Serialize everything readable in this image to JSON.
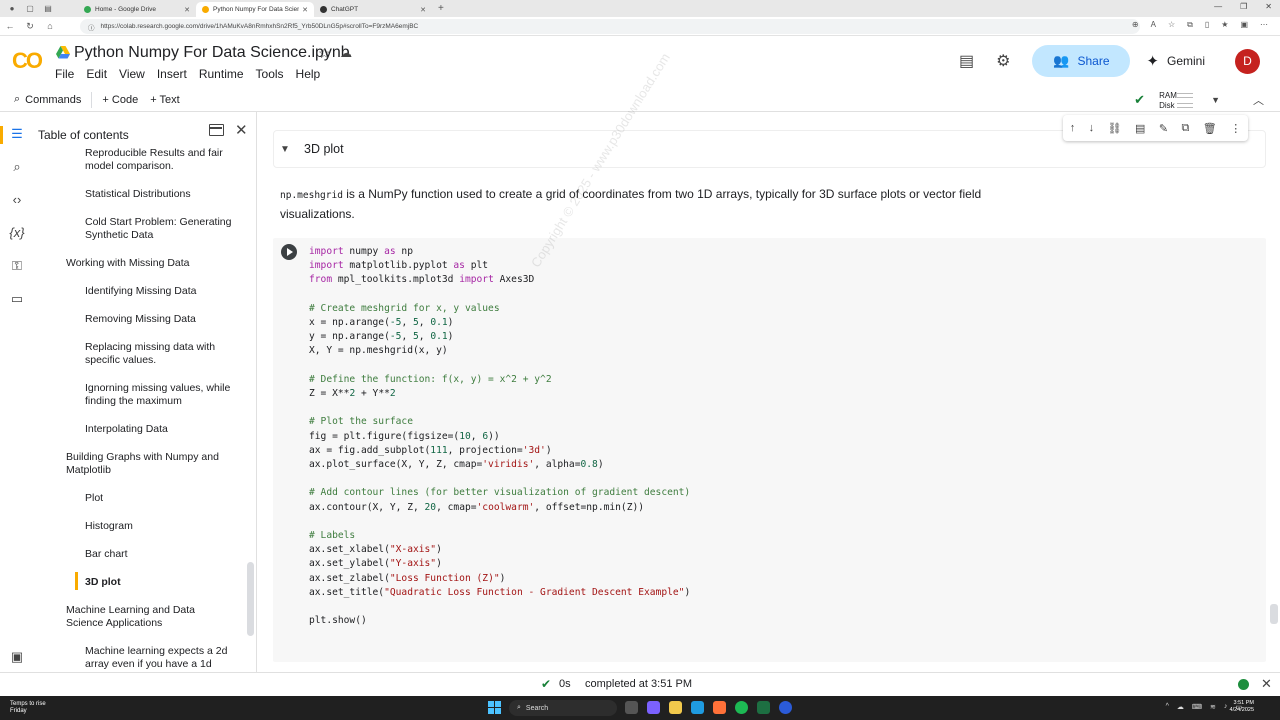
{
  "browser": {
    "tabs": [
      {
        "label": "Home - Google Drive",
        "active": false
      },
      {
        "label": "Python Numpy For Data Science.ip",
        "active": true
      },
      {
        "label": "ChatGPT",
        "active": false
      }
    ],
    "new_tab": "+",
    "url": "https://colab.research.google.com/drive/1hAMuKvA8nRmhxhSn2Rf5_Yrb50DLnG5p#scrollTo=F9rzMA6emjBC"
  },
  "header": {
    "logo": "CO",
    "notebook_title": "Python Numpy For Data Science.ipynb",
    "menu": [
      "File",
      "Edit",
      "View",
      "Insert",
      "Runtime",
      "Tools",
      "Help"
    ],
    "share_label": "Share",
    "gemini_label": "Gemini",
    "avatar_initial": "D"
  },
  "toolbar": {
    "commands_label": "Commands",
    "code_label": "+ Code",
    "text_label": "+ Text",
    "ram_label": "RAM",
    "disk_label": "Disk"
  },
  "toc": {
    "title": "Table of contents",
    "items": [
      {
        "label": "Reproducible Results and fair model comparison.",
        "level": 2
      },
      {
        "label": "Statistical Distributions",
        "level": 2
      },
      {
        "label": "Cold Start Problem: Generating Synthetic Data",
        "level": 2
      },
      {
        "label": "Working with Missing Data",
        "level": 1
      },
      {
        "label": "Identifying Missing Data",
        "level": 2
      },
      {
        "label": "Removing Missing Data",
        "level": 2
      },
      {
        "label": "Replacing missing data with specific values.",
        "level": 2
      },
      {
        "label": "Ignorning missing values, while finding the maximum",
        "level": 2
      },
      {
        "label": "Interpolating Data",
        "level": 2
      },
      {
        "label": "Building Graphs with Numpy and Matplotlib",
        "level": 1
      },
      {
        "label": "Plot",
        "level": 2
      },
      {
        "label": "Histogram",
        "level": 2
      },
      {
        "label": "Bar chart",
        "level": 2
      },
      {
        "label": "3D plot",
        "level": 2,
        "selected": true
      },
      {
        "label": "Machine Learning and Data Science Applications",
        "level": 1
      },
      {
        "label": "Machine learning expects a 2d array even if you have a 1d",
        "level": 2
      }
    ]
  },
  "main": {
    "section_title": "3D plot",
    "markdown_code": "np.meshgrid",
    "markdown_text": " is a NumPy function used to create a grid of coordinates from two 1D arrays, typically for 3D surface plots or vector field visualizations.",
    "watermark": "Copyright © 2025 - www.p30download.com"
  },
  "status": {
    "duration": "0s",
    "completed_text": "completed at 3:51 PM"
  },
  "taskbar": {
    "weather_line1": "Temps to rise",
    "weather_line2": "Friday",
    "search_placeholder": "Search",
    "clock_time": "3:51 PM",
    "clock_date": "4/24/2025"
  },
  "colors": {
    "accent_orange": "#f9ab00",
    "share_bg": "#c2e7ff",
    "success_green": "#188038",
    "avatar_red": "#c5221f"
  }
}
